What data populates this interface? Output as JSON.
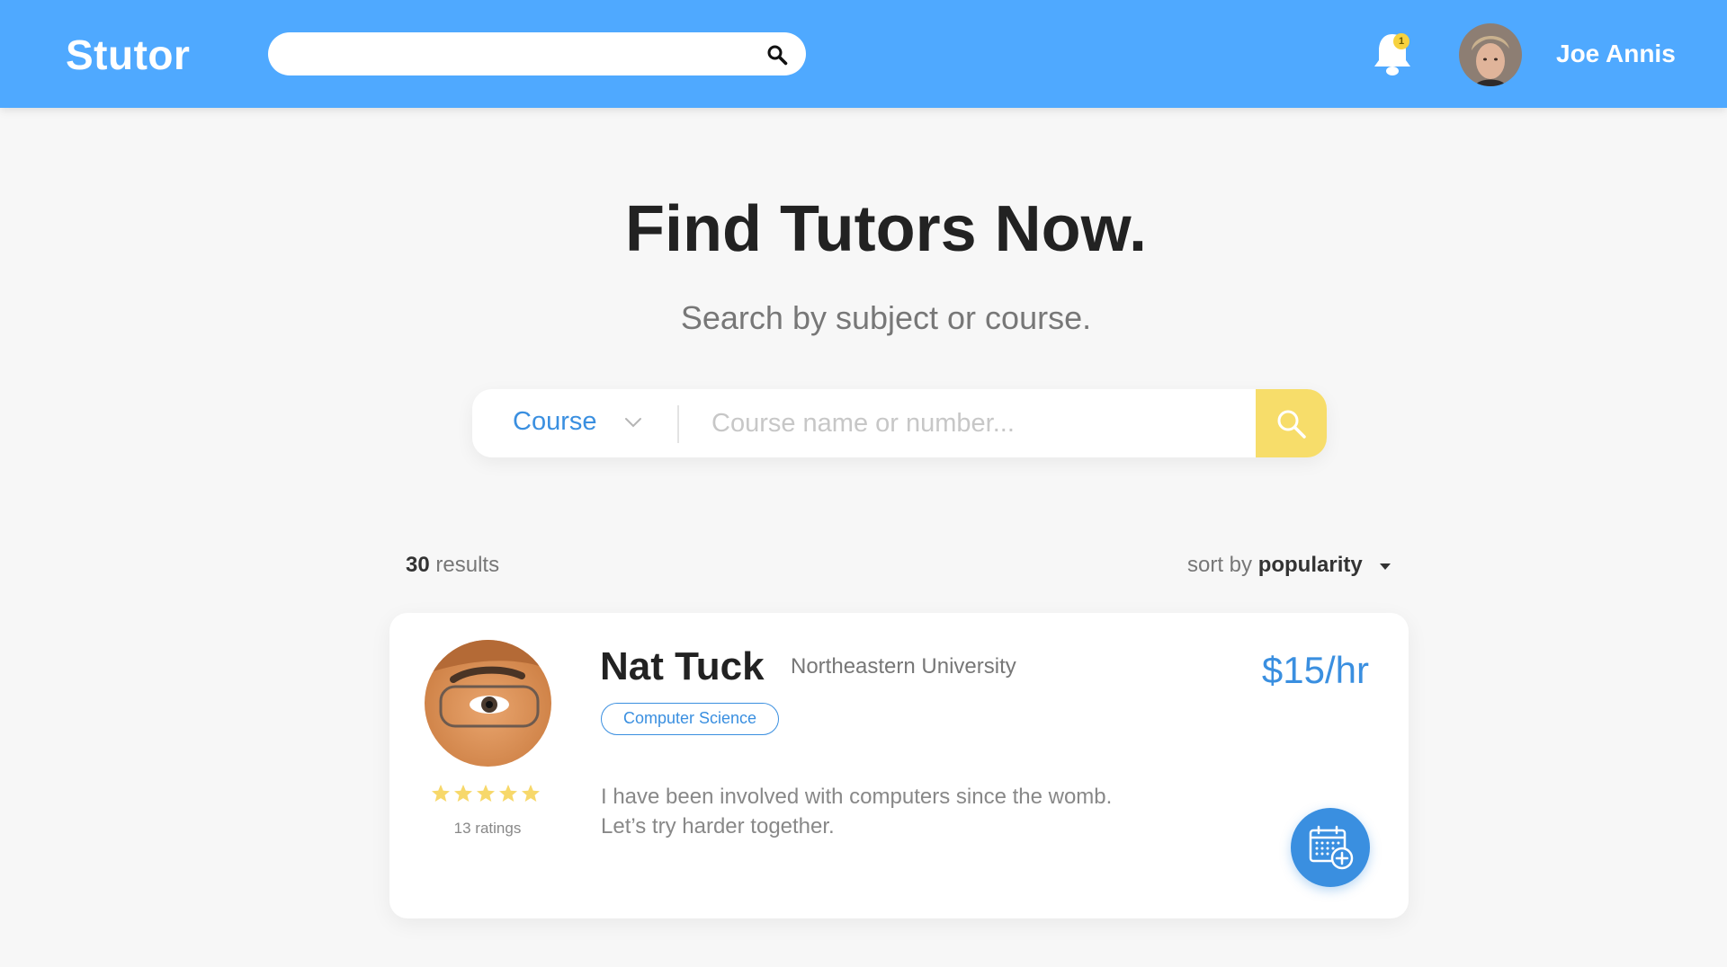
{
  "header": {
    "logo": "Stutor",
    "search_value": "",
    "notifications_count": "1",
    "user_name": "Joe Annis"
  },
  "hero": {
    "title": "Find Tutors Now.",
    "subtitle": "Search by subject or course."
  },
  "search": {
    "type_selected": "Course",
    "placeholder": "Course name or number..."
  },
  "results": {
    "count": "30",
    "count_label": "results",
    "sort_prefix": "sort by",
    "sort_value": "popularity"
  },
  "tutors": [
    {
      "name": "Nat Tuck",
      "school": "Northeastern University",
      "subject": "Computer Science",
      "price": "$15/hr",
      "rating_stars": 5,
      "ratings_label": "13 ratings",
      "bio_line1": "I have been involved with computers since the womb.",
      "bio_line2": "Let’s try harder together."
    }
  ],
  "colors": {
    "header_bg": "#4fa9ff",
    "accent_blue": "#3a8fe0",
    "search_button": "#f7dd6a",
    "star": "#f7d86a",
    "badge": "#f7d23e"
  }
}
